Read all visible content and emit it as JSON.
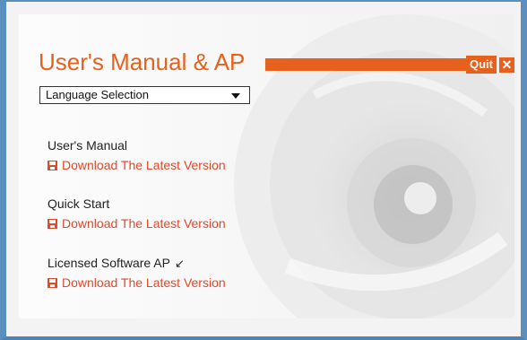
{
  "header": {
    "title": "User's Manual & AP",
    "quit_label": "Quit",
    "close_glyph": "✕"
  },
  "language": {
    "selected": "Language Selection"
  },
  "sections": [
    {
      "heading": "User's Manual",
      "link": "Download The Latest Version"
    },
    {
      "heading": "Quick Start",
      "link": "Download The Latest Version"
    },
    {
      "heading": "Licensed Software AP",
      "link": "Download The Latest Version",
      "heading_icon": "↙"
    }
  ],
  "colors": {
    "accent": "#e6611d",
    "link": "#e0492a",
    "frame": "#5b8fbe"
  },
  "icons": {
    "download": "floppy-disk-icon",
    "ap_arrow": "arrow-down-left-icon"
  }
}
